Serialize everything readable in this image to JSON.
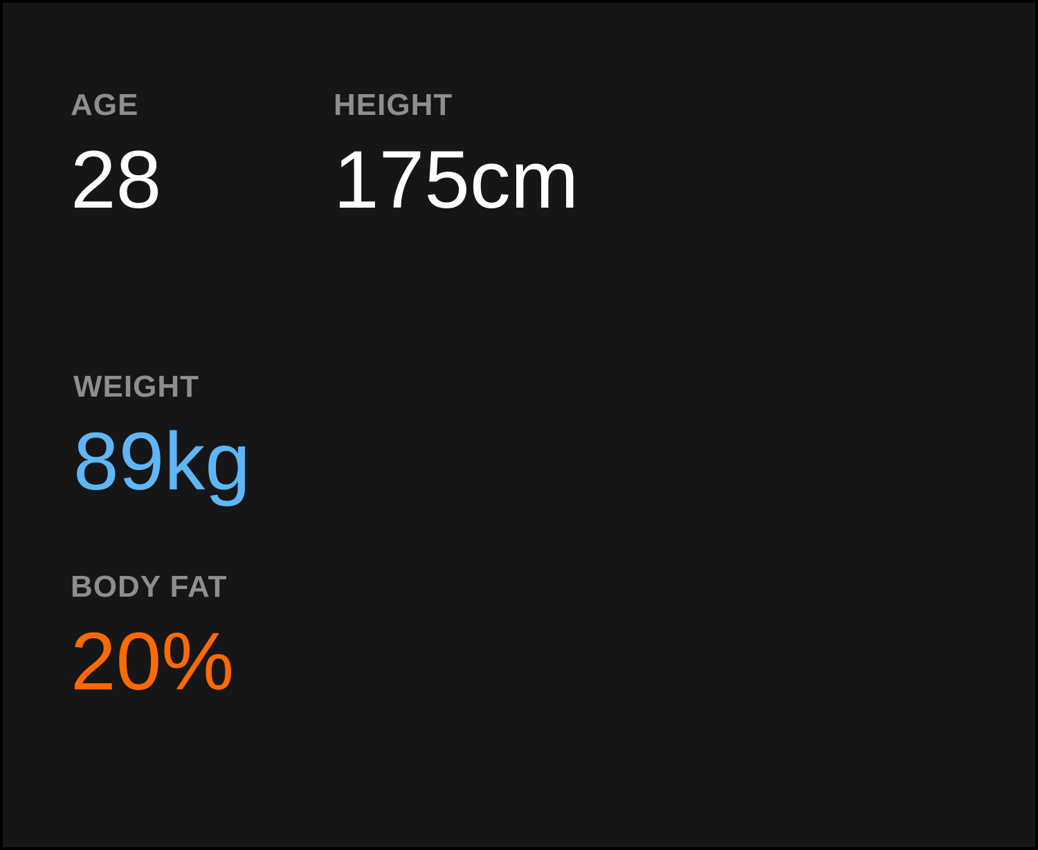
{
  "colors": {
    "background": "#161616",
    "label": "#8e8e8e",
    "value_default": "#ffffff",
    "value_weight": "#5eb6f7",
    "value_body_fat": "#ff6a00"
  },
  "stats": {
    "age": {
      "label": "AGE",
      "value": "28"
    },
    "height": {
      "label": "HEIGHT",
      "value": "175cm"
    },
    "weight": {
      "label": "WEIGHT",
      "value": "89kg"
    },
    "body_fat": {
      "label": "BODY FAT",
      "value": "20%"
    }
  }
}
